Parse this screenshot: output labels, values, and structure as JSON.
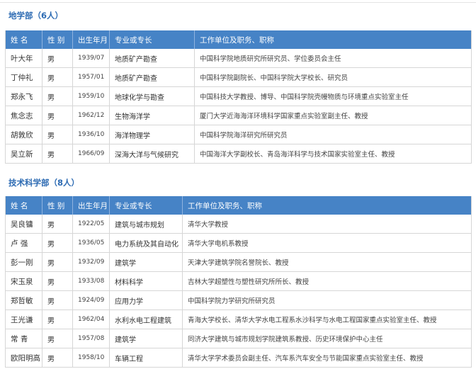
{
  "colors": {
    "header_bg": "#4683c6",
    "header_text": "#ffffff",
    "section_title": "#2d6bb3"
  },
  "earth_division": {
    "title": "地学部（6人）",
    "headers": {
      "name": "姓 名",
      "gender": "性 别",
      "birth": "出生年月",
      "specialty": "专业或专长",
      "affiliation": "工作单位及职务、职称"
    },
    "rows": [
      {
        "name": "叶大年",
        "gender": "男",
        "birth": "1939/07",
        "specialty": "地质矿产勘查",
        "affiliation": "中国科学院地质研究所研究员、学位委员会主任"
      },
      {
        "name": "丁仲礼",
        "gender": "男",
        "birth": "1957/01",
        "specialty": "地质矿产勘查",
        "affiliation": "中国科学院副院长、中国科学院大学校长、研究员"
      },
      {
        "name": "郑永飞",
        "gender": "男",
        "birth": "1959/10",
        "specialty": "地球化学与勘查",
        "affiliation": "中国科技大学教授、博导、中国科学院壳幔物质与环境重点实验室主任"
      },
      {
        "name": "焦念志",
        "gender": "男",
        "birth": "1962/12",
        "specialty": "生物海洋学",
        "affiliation": "厦门大学近海海洋环境科学国家重点实验室副主任、教授"
      },
      {
        "name": "胡敦欣",
        "gender": "男",
        "birth": "1936/10",
        "specialty": "海洋物理学",
        "affiliation": "中国科学院海洋研究所研究员"
      },
      {
        "name": "吴立新",
        "gender": "男",
        "birth": "1966/09",
        "specialty": "深海大洋与气候研究",
        "affiliation": "中国海洋大学副校长、青岛海洋科学与技术国家实验室主任、教授"
      }
    ]
  },
  "tech_division": {
    "title": "技术科学部（8人）",
    "headers": {
      "name": "姓 名",
      "gender": "性 别",
      "birth": "出生年月",
      "specialty": "专业或专长",
      "affiliation": "工作单位及职务、职称"
    },
    "rows": [
      {
        "name": "吴良镛",
        "gender": "男",
        "birth": "1922/05",
        "specialty": "建筑与城市规划",
        "affiliation": "清华大学教授"
      },
      {
        "name": "卢 强",
        "gender": "男",
        "birth": "1936/05",
        "specialty": "电力系统及其自动化",
        "affiliation": "清华大学电机系教授"
      },
      {
        "name": "彭一刚",
        "gender": "男",
        "birth": "1932/09",
        "specialty": "建筑学",
        "affiliation": "天津大学建筑学院名誉院长、教授"
      },
      {
        "name": "宋玉泉",
        "gender": "男",
        "birth": "1933/08",
        "specialty": "材料科学",
        "affiliation": "吉林大学超塑性与塑性研究所所长、教授"
      },
      {
        "name": "郑哲敏",
        "gender": "男",
        "birth": "1924/09",
        "specialty": "应用力学",
        "affiliation": "中国科学院力学研究所研究员"
      },
      {
        "name": "王光谦",
        "gender": "男",
        "birth": "1962/04",
        "specialty": "水利水电工程建筑",
        "affiliation": "青海大学校长、清华大学水电工程系水沙科学与水电工程国家重点实验室主任、教授"
      },
      {
        "name": "常 青",
        "gender": "男",
        "birth": "1957/08",
        "specialty": "建筑学",
        "affiliation": "同济大学建筑与城市规划学院建筑系教授、历史环境保护中心主任"
      },
      {
        "name": "欧阳明高",
        "gender": "男",
        "birth": "1958/10",
        "specialty": "车辆工程",
        "affiliation": "清华大学学术委员会副主任、汽车系汽车安全与节能国家重点实验室主任、教授"
      }
    ]
  }
}
